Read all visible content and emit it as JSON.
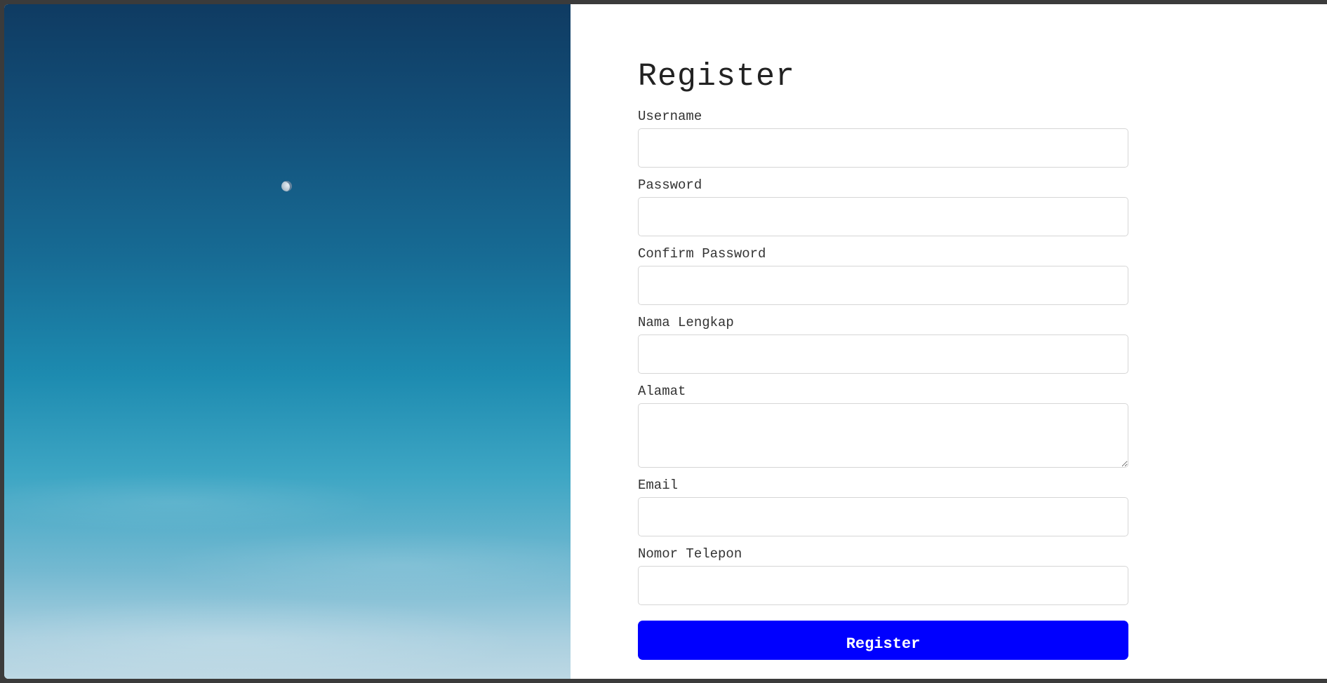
{
  "page": {
    "title": "Register"
  },
  "form": {
    "fields": [
      {
        "label": "Username",
        "value": "",
        "type": "text"
      },
      {
        "label": "Password",
        "value": "",
        "type": "password"
      },
      {
        "label": "Confirm Password",
        "value": "",
        "type": "password"
      },
      {
        "label": "Nama Lengkap",
        "value": "",
        "type": "text"
      },
      {
        "label": "Alamat",
        "value": "",
        "type": "textarea"
      },
      {
        "label": "Email",
        "value": "",
        "type": "email"
      },
      {
        "label": "Nomor Telepon",
        "value": "",
        "type": "tel"
      }
    ],
    "submit_label": "Register"
  },
  "colors": {
    "accent": "#0000ff",
    "sky_top": "#0f3b62",
    "sky_bottom": "#bdd8e4"
  }
}
